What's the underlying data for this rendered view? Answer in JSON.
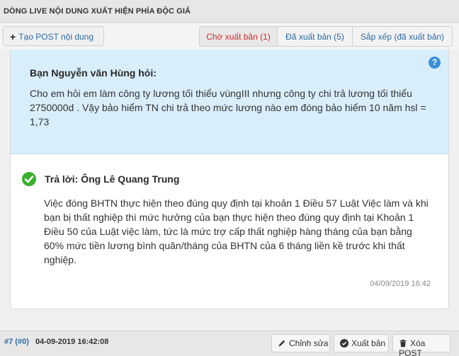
{
  "header": {
    "title": "DÒNG LIVE NỘI DUNG XUẤT HIỆN PHÍA ĐỘC GIẢ"
  },
  "toolbar": {
    "create_label": "Tạo POST nội dung",
    "tabs": [
      {
        "label": "Chờ xuất bản (1)",
        "active": true
      },
      {
        "label": "Đã xuất bản (5)",
        "active": false
      },
      {
        "label": "Sắp xếp (đã xuất bản)",
        "active": false
      }
    ]
  },
  "question": {
    "help_glyph": "?",
    "asker": "Bạn Nguyễn văn Hùng hỏi:",
    "text": "Cho em hỏi em làm công ty lương tối thiểu vùngIII nhưng công ty chi trả lương tối thiểu 2750000d . Vậy bảo hiểm TN chi trả theo mức lương nào em đóng bảo hiểm 10 năm hsl = 1,73"
  },
  "answer": {
    "title": "Trả lời: Ông Lê Quang Trung",
    "text": "Việc đóng BHTN thực hiện theo đúng quy định tại khoản 1 Điều 57 Luật Việc làm và khi bạn bị thất nghiệp thì mức hưởng của bạn thực hiện theo đúng quy định tại Khoản 1 Điều 50 của Luật việc làm, tức là mức trợ cấp thất nghiệp hàng tháng của bạn bằng 60% mức tiền lương bình quân/tháng của BHTN của 6 tháng liền kề trước khi thất nghiệp.",
    "date": "04/09/2019 16:42"
  },
  "footer": {
    "post_id": "#7 (#0)",
    "post_date": "04-09-2019 16:42:08",
    "edit_label": "Chỉnh sửa",
    "publish_label": "Xuất bản",
    "delete_label": "Xóa POST"
  },
  "colors": {
    "question_bg": "#d9eefb",
    "accent": "#2b6aa6",
    "active_tab": "#c9302c",
    "check": "#3cae2e"
  },
  "icons": {
    "create": "plus-icon",
    "help": "question-icon",
    "answer": "check-circle-icon",
    "edit": "pencil-icon",
    "publish": "check-circle-icon",
    "delete": "trash-icon"
  }
}
